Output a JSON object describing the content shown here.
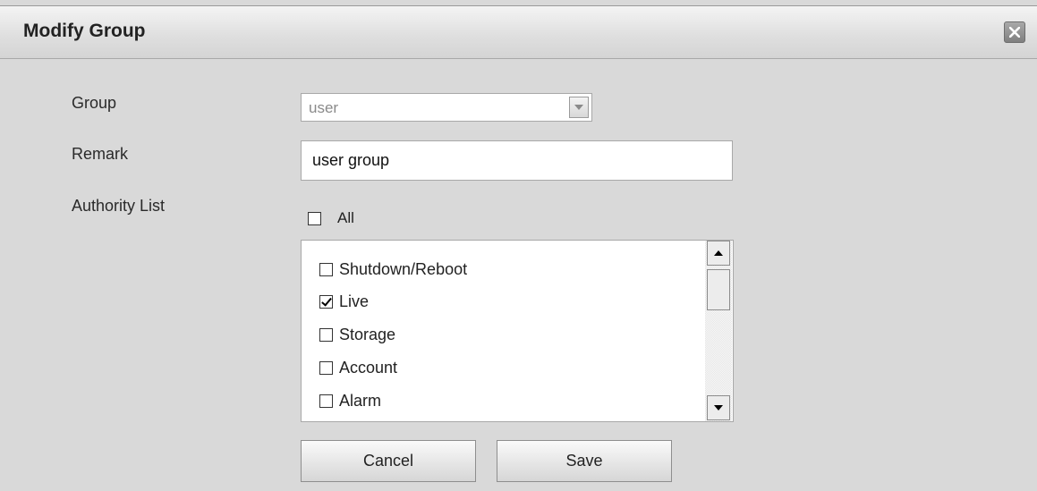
{
  "dialog": {
    "title": "Modify Group",
    "close_icon": "close-icon"
  },
  "form": {
    "group": {
      "label": "Group",
      "value": "user"
    },
    "remark": {
      "label": "Remark",
      "value": "user group"
    },
    "authority": {
      "label": "Authority List",
      "all": {
        "label": "All",
        "checked": false
      },
      "items": [
        {
          "label": "Shutdown/Reboot",
          "checked": false
        },
        {
          "label": "Live",
          "checked": true
        },
        {
          "label": "Storage",
          "checked": false
        },
        {
          "label": "Account",
          "checked": false
        },
        {
          "label": "Alarm",
          "checked": false
        }
      ]
    }
  },
  "buttons": {
    "cancel": "Cancel",
    "save": "Save"
  }
}
